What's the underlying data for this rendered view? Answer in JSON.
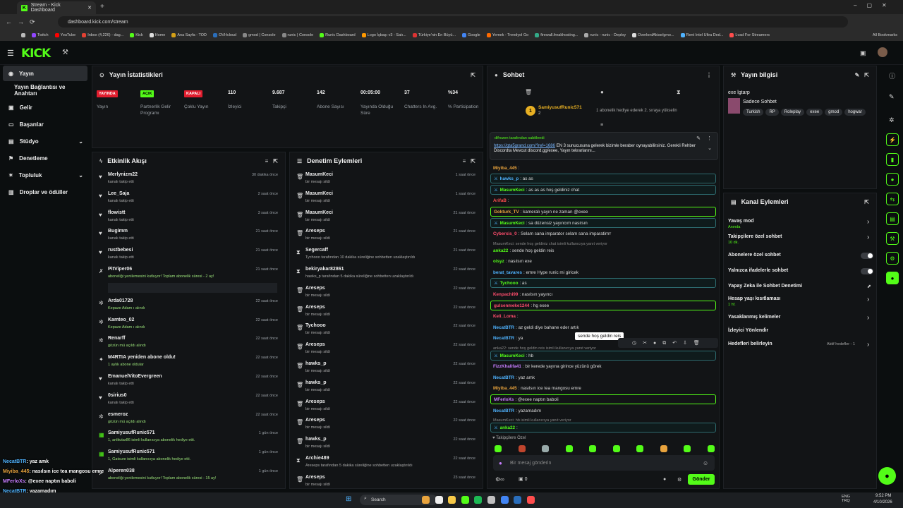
{
  "browser": {
    "tab_title": "Stream - Kick Dashboard",
    "url": "dashboard.kick.com/stream",
    "bookmarks": [
      "Twitch",
      "YouTube",
      "Inbox (4,226) - dag...",
      "Kick",
      "Home",
      "Ana Sayfa - TOD",
      "OVHcloud",
      "gmod | Console",
      "runic | Console",
      "Runic Dashboard",
      "Logo İşbaşı v3 - Satı...",
      "Türkiye'nin En Büyü...",
      "Google",
      "Yemek - Trendyol Go",
      "firewall.freakhosting...",
      "runic - runic - Deploy",
      "OverlordAkise/gmo...",
      "Rent Intel Ultra Ded...",
      "Lvad For Streamers"
    ],
    "all_bookmarks": "All Bookmarks"
  },
  "brand": {
    "logo": "KICK",
    "accent": "#53fc18"
  },
  "nav": {
    "items": [
      {
        "label": "Yayın"
      },
      {
        "label": "Yayın Bağlantısı ve Anahtarı"
      },
      {
        "label": "Gelir"
      },
      {
        "label": "Başarılar"
      },
      {
        "label": "Stüdyo"
      },
      {
        "label": "Denetleme"
      },
      {
        "label": "Topluluk"
      },
      {
        "label": "Droplar ve ödüller"
      }
    ]
  },
  "stats": {
    "title": "Yayın İstatistikleri",
    "items": [
      {
        "badge": "YAYINDA",
        "label": "Yayın"
      },
      {
        "badge": "AÇIK",
        "label": "Partnerlik Gelir Programı"
      },
      {
        "badge": "KAPALI",
        "label": "Çoklu Yayın"
      },
      {
        "value": "110",
        "label": "İzleyici"
      },
      {
        "value": "9.687",
        "label": "Takipçi"
      },
      {
        "value": "142",
        "label": "Abone Sayısı"
      },
      {
        "value": "00:05:00",
        "label": "Yayında Olduğu Süre"
      },
      {
        "value": "37",
        "label": "Chatters In Avg."
      },
      {
        "value": "%34",
        "label": "% Participation"
      }
    ]
  },
  "activity": {
    "title": "Etkinlik Akışı",
    "rows": [
      {
        "name": "Merlynizm22",
        "sub": "kanalı takip etti",
        "time": "30 dakika önce"
      },
      {
        "name": "Lee_Saja",
        "sub": "kanalı takip etti",
        "time": "2 saat önce"
      },
      {
        "name": "flowistt",
        "sub": "kanalı takip etti",
        "time": "3 saat önce"
      },
      {
        "name": "Bugimm",
        "sub": "kanalı takip etti",
        "time": "21 saat önce"
      },
      {
        "name": "rustbebesi",
        "sub": "kanalı takip etti",
        "time": "21 saat önce"
      },
      {
        "name": "PitViper06",
        "sub": "aboneliği yenilemesini kutluyor! Toplam abonelik süresi - 2 ay!",
        "time": "21 saat önce"
      },
      {
        "name": "Arda01728",
        "sub": "Kepaze Adam ı alındı",
        "time": "22 saat önce"
      },
      {
        "name": "Kamteo_02",
        "sub": "Kepaze Adam ı alındı",
        "time": "22 saat önce"
      },
      {
        "name": "Renarff",
        "sub": "gözün mü açıldı alındı",
        "time": "22 saat önce"
      },
      {
        "name": "M4RTIA yeniden abone oldu!",
        "sub": "1 aylık abone oldular",
        "time": "22 saat önce"
      },
      {
        "name": "EmanuelVitoEvergreen",
        "sub": "kanalı takip etti",
        "time": "22 saat önce"
      },
      {
        "name": "0sirius0",
        "sub": "kanalı takip etti",
        "time": "22 saat önce"
      },
      {
        "name": "esmeroz",
        "sub": "gözün mü açıldı alındı",
        "time": "22 saat önce"
      },
      {
        "name": "SamiyusufRunic571",
        "sub": "1, anlitutar86 isimli kullanıcıya abonelik hediye etti.",
        "time": "1 gün önce"
      },
      {
        "name": "SamiyusufRunic571",
        "sub": "1, Gatsure isimli kullanıcıya abonelik hediye etti.",
        "time": "1 gün önce"
      },
      {
        "name": "Alperen038",
        "sub": "aboneliği yenilemesini kutluyor! Toplam abonelik süresi - 15 ay!",
        "time": "1 gün önce"
      }
    ]
  },
  "moderation": {
    "title": "Denetim Eylemleri",
    "rows": [
      {
        "name": "MasumKeci",
        "sub": "bir mesajı sildi",
        "time": "1 saat önce"
      },
      {
        "name": "MasumKeci",
        "sub": "bir mesajı sildi",
        "time": "1 saat önce"
      },
      {
        "name": "MasumKeci",
        "sub": "bir mesajı sildi",
        "time": "21 saat önce"
      },
      {
        "name": "Areseps",
        "sub": "bir mesajı sildi",
        "time": "21 saat önce"
      },
      {
        "name": "Segercaff",
        "sub": "Tychooo tarafından 10 dakika süreliğine sohbetten uzaklaştırıldı",
        "time": "21 saat önce"
      },
      {
        "name": "bekiryakar82861",
        "sub": "hawks_p tarafından 5 dakika süreliğine sohbetten uzaklaştırıldı",
        "time": "22 saat önce"
      },
      {
        "name": "Areseps",
        "sub": "bir mesajı sildi",
        "time": "22 saat önce"
      },
      {
        "name": "Areseps",
        "sub": "bir mesajı sildi",
        "time": "22 saat önce"
      },
      {
        "name": "Tychooo",
        "sub": "bir mesajı sildi",
        "time": "22 saat önce"
      },
      {
        "name": "Areseps",
        "sub": "bir mesajı sildi",
        "time": "22 saat önce"
      },
      {
        "name": "hawks_p",
        "sub": "bir mesajı sildi",
        "time": "22 saat önce"
      },
      {
        "name": "hawks_p",
        "sub": "bir mesajı sildi",
        "time": "22 saat önce"
      },
      {
        "name": "Areseps",
        "sub": "bir mesajı sildi",
        "time": "22 saat önce"
      },
      {
        "name": "Areseps",
        "sub": "bir mesajı sildi",
        "time": "22 saat önce"
      },
      {
        "name": "hawks_p",
        "sub": "bir mesajı sildi",
        "time": "22 saat önce"
      },
      {
        "name": "Archie489",
        "sub": "Areseps tarafından 5 dakika süreliğine sohbetten uzaklaştırıldı",
        "time": "22 saat önce"
      },
      {
        "name": "Areseps",
        "sub": "bir mesajı sildi",
        "time": "23 saat önce"
      }
    ]
  },
  "chat": {
    "title": "Sohbet",
    "gifter": {
      "name": "SamiyusufRunic571",
      "count": "2",
      "text": "1 abonelik hediye ederek 2. sıraya yükselin"
    },
    "pinned": {
      "by": "difrozen tarafından sabitlendi",
      "link": "https://gta5grand.com/?ref=1686",
      "text": " EN 3 sunucusuna gelerek bizimle beraber oynayabilirsiniz. Gerekli Rehber Discordta Mevcut discord.gg/exee, Yayın tekrarlarını..."
    },
    "messages": [
      {
        "user": "Miyiba_445",
        "text": ":",
        "color": "#e8a33d",
        "style": ""
      },
      {
        "user": "hawks_p",
        "text": ": as as",
        "color": "#4fb3ff",
        "style": "hb"
      },
      {
        "user": "MasumKeci",
        "text": ": as as as hoş geldiniz chat",
        "color": "#53fc18",
        "style": "hb"
      },
      {
        "user": "ArifaB",
        "text": ":",
        "color": "#ff4d4d",
        "style": ""
      },
      {
        "user": "Gokturk_TV",
        "text": ": kameralı yayın ne zaman @exee",
        "color": "#e8a33d",
        "style": "hl"
      },
      {
        "user": "MasumKeci",
        "text": ": sa düzensiz yayıncım nasılsın",
        "color": "#53fc18",
        "style": "hb"
      },
      {
        "user": "Cyberxis_0",
        "text": ": Selam sana imparator selam sana imparatirrrr",
        "color": "#ff4d6d",
        "style": ""
      },
      {
        "user": "anka22",
        "text": ": sende hoş geldin reis",
        "color": "#53fc18",
        "style": ""
      },
      {
        "user": "oisyz",
        "text": ": nasılsın exe",
        "color": "#53fc18",
        "style": ""
      },
      {
        "user": "berat_tavares",
        "text": ": emre Hype runic mi giricek",
        "color": "#4fb3ff",
        "style": ""
      },
      {
        "user": "Tychooo",
        "text": ": as",
        "color": "#53fc18",
        "style": "hb"
      },
      {
        "user": "Kenpachi99",
        "text": ": nasılsın yayıncı",
        "color": "#ff4d6d",
        "style": ""
      },
      {
        "user": "gulsenmeke1244",
        "text": ": hg exee",
        "color": "#ff4d6d",
        "style": "hl"
      },
      {
        "user": "Keli_Loma",
        "text": ":",
        "color": "#ff4d6d",
        "style": ""
      },
      {
        "user": "NecatBTR",
        "text": ": az geldi diye bahane eder artık",
        "color": "#4fb3ff",
        "style": ""
      },
      {
        "user": "NecatBTR",
        "text": ": ya",
        "color": "#4fb3ff",
        "style": ""
      },
      {
        "user": "MasumKeci",
        "text": ": hb",
        "color": "#53fc18",
        "style": "hb"
      },
      {
        "user": "FizzKhalifa41",
        "text": ": bir kerede yayına girince yüzünü görek",
        "color": "#c77dff",
        "style": ""
      },
      {
        "user": "NecatBTR",
        "text": ": yaz amk",
        "color": "#4fb3ff",
        "style": ""
      },
      {
        "user": "Miyiba_445",
        "text": ": nasılsın ice tea mangosu emre",
        "color": "#e8a33d",
        "style": ""
      },
      {
        "user": "MFerloXs",
        "text": ": @exee naptın baboli",
        "color": "#c77dff",
        "style": "hl"
      },
      {
        "user": "NecatBTR",
        "text": ": yazamadım",
        "color": "#4fb3ff",
        "style": ""
      },
      {
        "user": "anka22",
        "text": ":",
        "color": "#53fc18",
        "style": "hb"
      }
    ],
    "reply_1": "MasumKeci: sende hoş geldiniz chat isimli kullanıcıya yanıt veriyor",
    "reply_2": "anka22: sende hoş geldin reis isimli kullanıcıya yanıt veriyor",
    "reply_3": "MasumKeci: hb isimli kullanıcıya yanıt veriyor",
    "tooltip": "sende hoş geldin reis",
    "followers_only": "Takipçilere Özel",
    "placeholder": "Bir mesaj gönderin",
    "send_label": "Gönder",
    "points": "0"
  },
  "stream_info": {
    "title": "Yayın bilgisi",
    "stream_title": "exe lgtarp",
    "category": "Sadece Sohbet",
    "tags": [
      "Turkish",
      "RP",
      "Roleplay",
      "exee",
      "gmod",
      "hogwar"
    ]
  },
  "channel_actions": {
    "title": "Kanal Eylemleri",
    "items": [
      {
        "label": "Yavaş mod",
        "sub": "Anında"
      },
      {
        "label": "Takipçilere özel sohbet",
        "sub": "10 dk."
      },
      {
        "label": "Abonelere özel sohbet",
        "sub": ""
      },
      {
        "label": "Yalnızca ifadelerle sohbet",
        "sub": ""
      },
      {
        "label": "Yapay Zeka ile Sohbet Denetimi",
        "sub": ""
      },
      {
        "label": "Hesap yaşı kısıtlaması",
        "sub": "1 hf."
      },
      {
        "label": "Yasaklanmış kelimeler",
        "sub": ""
      },
      {
        "label": "İzleyici Yönlendir",
        "sub": ""
      },
      {
        "label": "Hedefleri belirleyin",
        "sub": ""
      }
    ],
    "goals_status": "Aktif hedefler - 1"
  },
  "overlay_chat": [
    {
      "user": "NecatBTR",
      "text": ": yaz amk",
      "color": "#4fb3ff"
    },
    {
      "user": "Miyiba_445",
      "text": ": nasılsın ice tea mangosu emre",
      "color": "#e8a33d"
    },
    {
      "user": "MFerloXs",
      "text": ": @exee naptın baboli",
      "color": "#c77dff"
    },
    {
      "user": "NecatBTR",
      "text": ": yazamadım",
      "color": "#4fb3ff"
    },
    {
      "user": "anka22",
      "text": ":",
      "color": "#53fc18"
    }
  ],
  "taskbar": {
    "search": "Search",
    "lang": "ENG TRQ",
    "time": "9:52 PM",
    "date": "4/10/2026"
  }
}
